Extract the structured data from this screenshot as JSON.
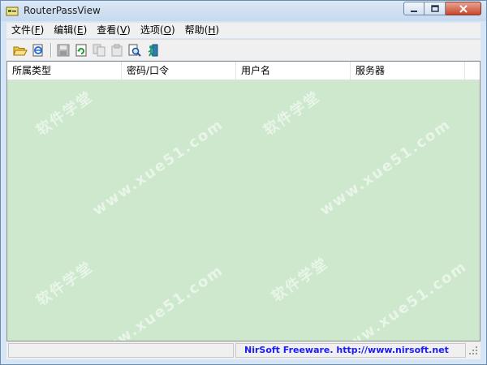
{
  "window": {
    "title": "RouterPassView",
    "icon": "router-key-icon"
  },
  "menubar": {
    "items": [
      {
        "label": "文件(",
        "mnemonic": "F",
        "suffix": ")"
      },
      {
        "label": "编辑(",
        "mnemonic": "E",
        "suffix": ")"
      },
      {
        "label": "查看(",
        "mnemonic": "V",
        "suffix": ")"
      },
      {
        "label": "选项(",
        "mnemonic": "O",
        "suffix": ")"
      },
      {
        "label": "帮助(",
        "mnemonic": "H",
        "suffix": ")"
      }
    ]
  },
  "toolbar": {
    "icons": [
      "open-folder-icon",
      "open-ie-file-icon",
      "save-icon",
      "refresh-icon",
      "copy-icon",
      "properties-icon",
      "find-icon",
      "exit-icon"
    ]
  },
  "list": {
    "columns": [
      "所属类型",
      "密码/口令",
      "用户名",
      "服务器"
    ],
    "rows": [],
    "background_color": "#cde8cd"
  },
  "watermarks": [
    "软件学堂",
    "www.xue51.com"
  ],
  "statusbar": {
    "left_text": "",
    "right_text": "NirSoft Freeware.  http://www.nirsoft.net",
    "link_color": "#1a1aff"
  }
}
